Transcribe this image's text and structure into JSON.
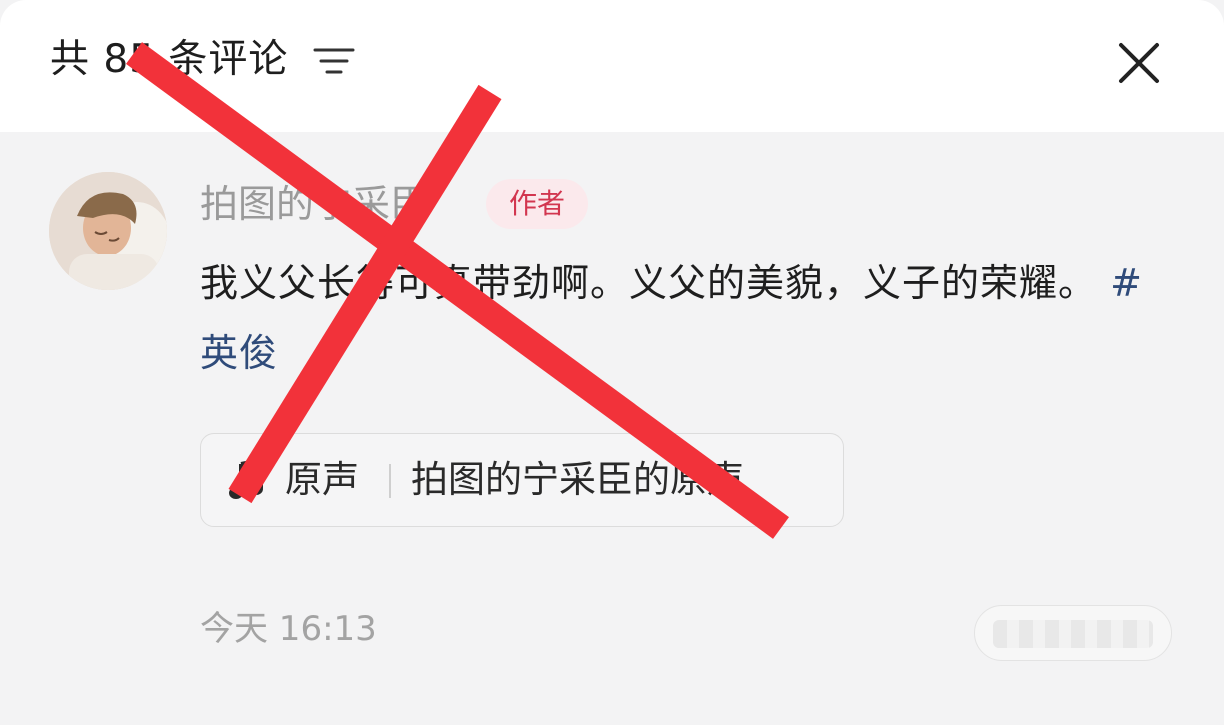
{
  "header": {
    "title": "共 85 条评论",
    "filter_icon": "filter-lines-icon",
    "close_icon": "close-icon"
  },
  "comment": {
    "avatar_icon": "user-avatar",
    "author": "拍图的宁采臣",
    "author_badge": "作者",
    "text_main": "我义父长得可真带劲啊。义父的美貌，义子的荣耀。",
    "hashtag": "#英俊",
    "sound": {
      "icon": "music-note-icon",
      "label": "原声",
      "name": "拍图的宁采臣的原声"
    },
    "timestamp": "今天 16:13"
  },
  "colors": {
    "header_bg": "#ffffff",
    "page_bg": "#f3f3f4",
    "badge_bg": "#fbe9ec",
    "badge_text": "#d2364f",
    "hashtag": "#2f4b7a",
    "cross_mark": "#f2323a"
  },
  "overlay": {
    "type": "red-cross-mark"
  }
}
